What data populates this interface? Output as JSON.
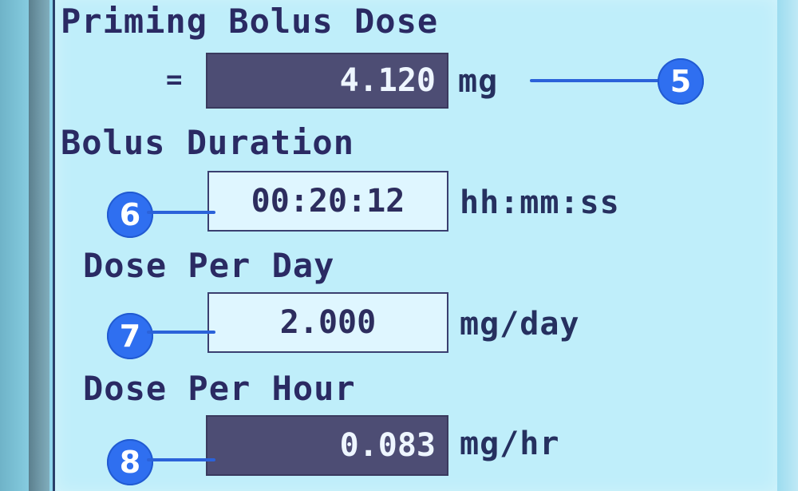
{
  "screen": {
    "colors": {
      "screen_bg": "#bfeefa",
      "text": "#2a2a63",
      "dark_field_bg": "#4d4d74",
      "dark_field_text": "#eef6ff",
      "light_field_bg": "#dff6ff",
      "callout": "#2f6ff0"
    }
  },
  "priming_bolus_dose": {
    "label": "Priming Bolus Dose",
    "equals": "=",
    "value": "4.120",
    "unit": "mg",
    "callout": "5"
  },
  "bolus_duration": {
    "label": "Bolus Duration",
    "value": "00:20:12",
    "unit": "hh:mm:ss",
    "callout": "6"
  },
  "dose_per_day": {
    "label": "Dose Per Day",
    "value": "2.000",
    "unit": "mg/day",
    "callout": "7"
  },
  "dose_per_hour": {
    "label": "Dose Per Hour",
    "value": "0.083",
    "unit": "mg/hr",
    "callout": "8"
  }
}
